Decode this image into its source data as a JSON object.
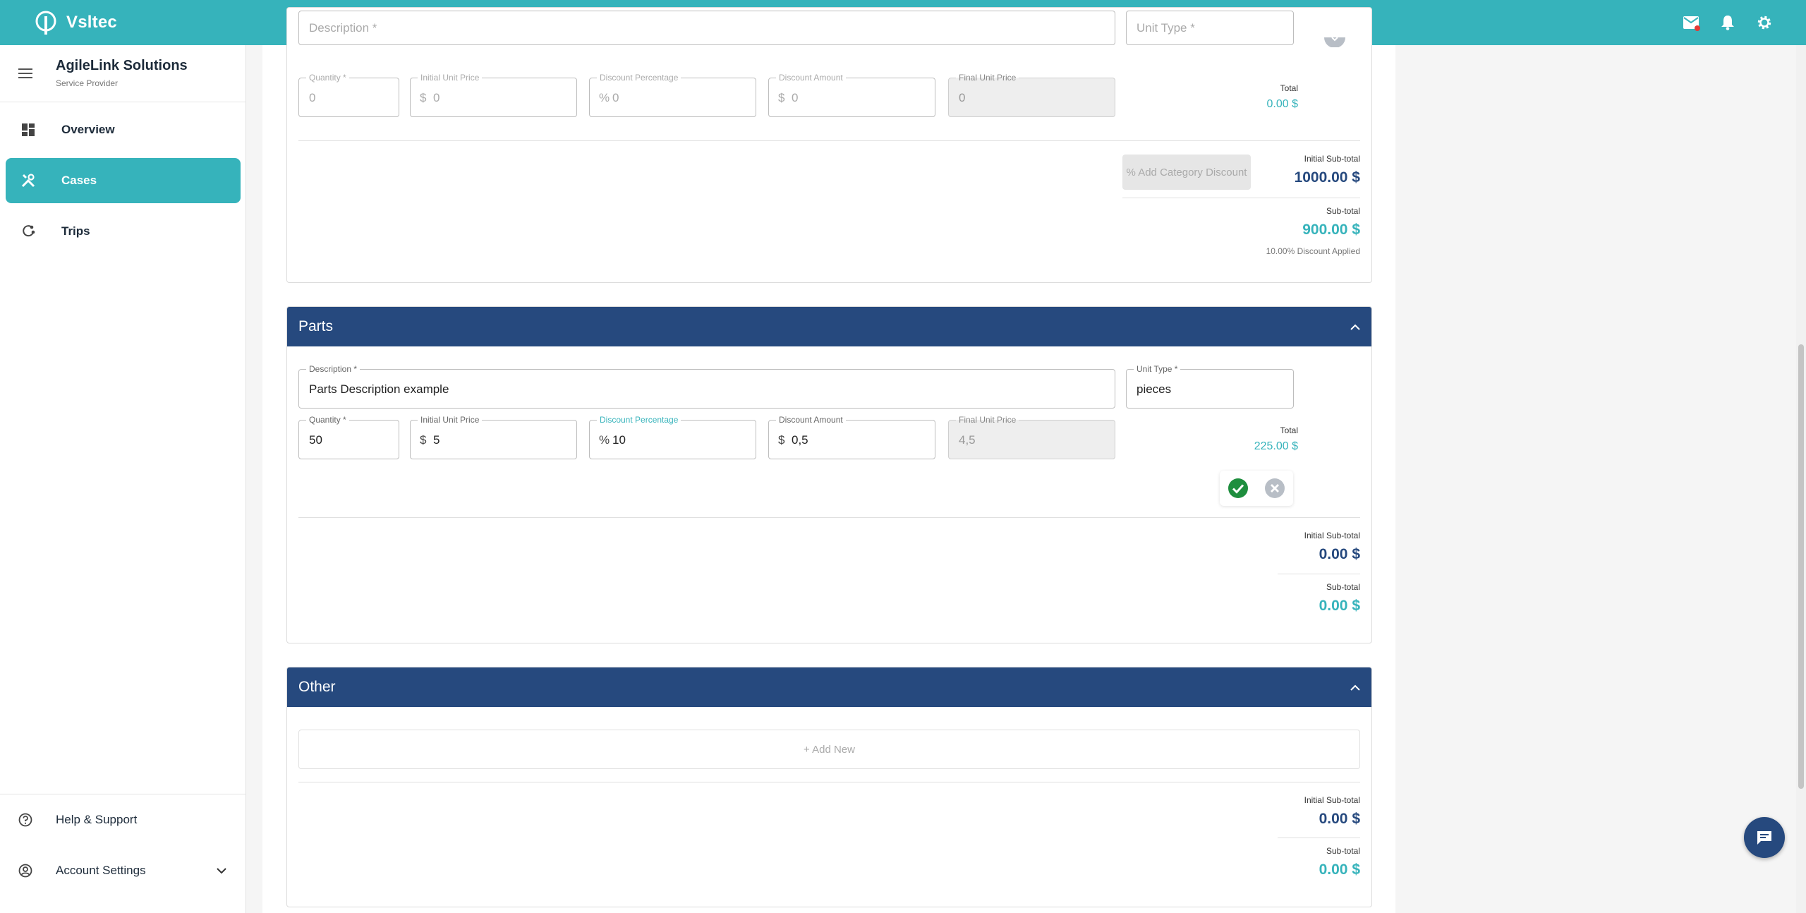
{
  "app": {
    "name": "Vsltec"
  },
  "sidebar": {
    "company_name": "AgileLink Solutions",
    "company_role": "Service Provider",
    "nav": [
      {
        "label": "Overview",
        "icon": "dashboard-icon"
      },
      {
        "label": "Cases",
        "icon": "tools-icon",
        "active": true
      },
      {
        "label": "Trips",
        "icon": "route-icon"
      }
    ],
    "bottom": [
      {
        "label": "Help & Support",
        "icon": "help-icon"
      },
      {
        "label": "Account Settings",
        "icon": "account-icon"
      }
    ]
  },
  "labor_section": {
    "row": {
      "description_label": "Description *",
      "unit_type_label": "Unit Type *",
      "quantity_label": "Quantity *",
      "quantity": "0",
      "initial_unit_price_label": "Initial Unit Price",
      "initial_unit_price": "0",
      "discount_percentage_label": "Discount Percentage",
      "discount_percentage": "0",
      "discount_amount_label": "Discount Amount",
      "discount_amount": "0",
      "final_unit_price_label": "Final Unit Price",
      "final_unit_price": "0",
      "total_label": "Total",
      "total": "0.00 $"
    },
    "add_category_discount": "% Add Category Discount",
    "initial_subtotal_label": "Initial Sub-total",
    "initial_subtotal": "1000.00 $",
    "subtotal_label": "Sub-total",
    "subtotal": "900.00 $",
    "discount_note": "10.00% Discount Applied"
  },
  "parts_section": {
    "title": "Parts",
    "row": {
      "description_label": "Description *",
      "description": "Parts Description example",
      "unit_type_label": "Unit Type *",
      "unit_type": "pieces",
      "quantity_label": "Quantity *",
      "quantity": "50",
      "initial_unit_price_label": "Initial Unit Price",
      "initial_unit_price": "5",
      "discount_percentage_label": "Discount Percentage",
      "discount_percentage": "10",
      "discount_amount_label": "Discount Amount",
      "discount_amount": "0,5",
      "final_unit_price_label": "Final Unit Price",
      "final_unit_price": "4,5",
      "total_label": "Total",
      "total": "225.00 $"
    },
    "initial_subtotal_label": "Initial Sub-total",
    "initial_subtotal": "0.00 $",
    "subtotal_label": "Sub-total",
    "subtotal": "0.00 $"
  },
  "other_section": {
    "title": "Other",
    "add_new": "+ Add New",
    "initial_subtotal_label": "Initial Sub-total",
    "initial_subtotal": "0.00 $",
    "subtotal_label": "Sub-total",
    "subtotal": "0.00 $"
  },
  "symbols": {
    "dollar": "$",
    "percent": "%"
  },
  "colors": {
    "topbar": "#36b3bb",
    "section_header": "#26497e",
    "accent": "#36b3bb",
    "success": "#1e8e3e"
  }
}
